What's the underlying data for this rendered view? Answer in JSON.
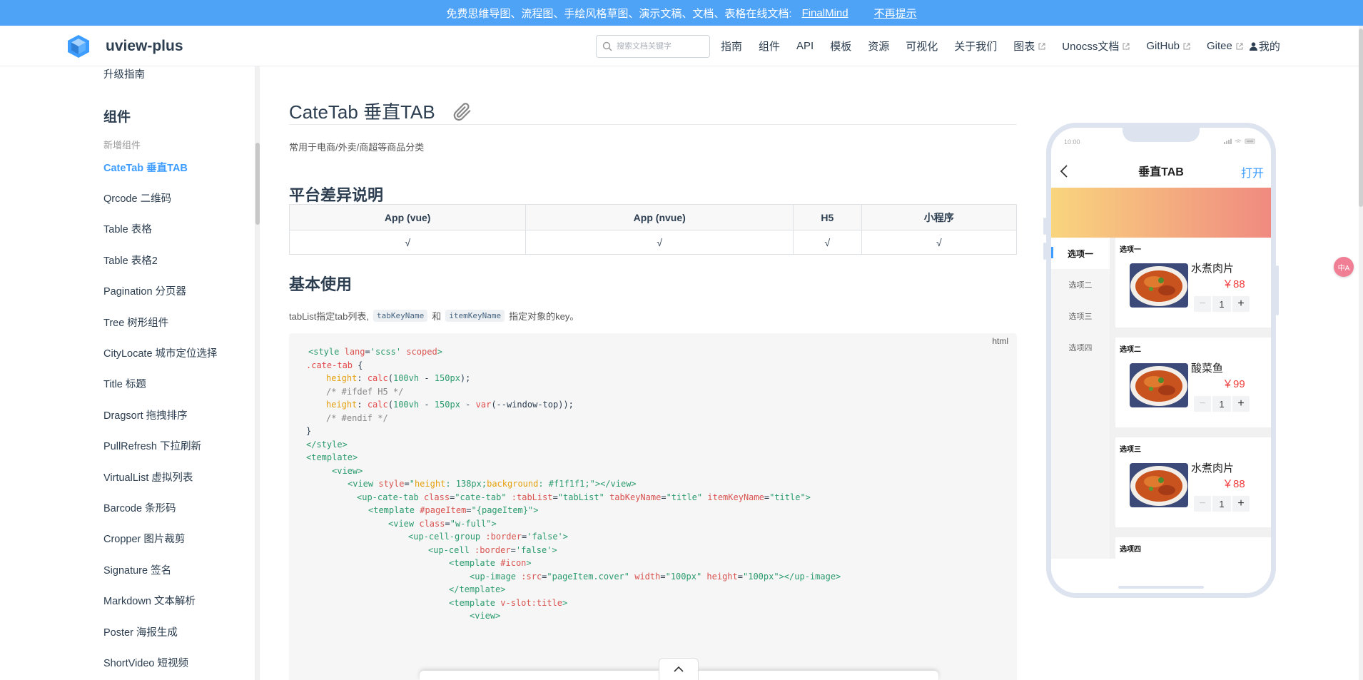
{
  "banner": {
    "text": "免费思维导图、流程图、手绘风格草图、演示文稿、文档、表格在线文档:",
    "link": "FinalMind",
    "dismiss": "不再提示"
  },
  "navbar": {
    "site_name": "uview-plus",
    "search_placeholder": "搜索文档关键字",
    "links": [
      "指南",
      "组件",
      "API",
      "模板",
      "资源",
      "可视化",
      "关于我们"
    ],
    "external_links": [
      "图表",
      "Unocss文档",
      "GitHub",
      "Gitee"
    ],
    "account": "我的"
  },
  "sidebar": {
    "upgrade": "升级指南",
    "group": "组件",
    "subgroup": "新增组件",
    "items": [
      "CateTab 垂直TAB",
      "Qrcode 二维码",
      "Table 表格",
      "Table 表格2",
      "Pagination 分页器",
      "Tree 树形组件",
      "CityLocate 城市定位选择",
      "Title 标题",
      "Dragsort 拖拽排序",
      "PullRefresh 下拉刷新",
      "VirtualList 虚拟列表",
      "Barcode 条形码",
      "Cropper 图片裁剪",
      "Signature 签名",
      "Markdown 文本解析",
      "Poster 海报生成",
      "ShortVideo 短视频"
    ]
  },
  "content": {
    "title": "CateTab 垂直TAB",
    "description": "常用于电商/外卖/商超等商品分类",
    "platform_heading": "平台差异说明",
    "platform_table": {
      "headers": [
        "App (vue)",
        "App (nvue)",
        "H5",
        "小程序"
      ],
      "row": [
        "√",
        "√",
        "√",
        "√"
      ]
    },
    "usage_heading": "基本使用",
    "usage_text_1": "tabList指定tab列表,",
    "usage_code_1": "tabKeyName",
    "usage_and": "和",
    "usage_code_2": "itemKeyName",
    "usage_text_2": "指定对象的key。",
    "code_lang": "html"
  },
  "phone": {
    "time": "10:00",
    "title": "垂直TAB",
    "open": "打开",
    "tabs": [
      "选项一",
      "选项二",
      "选项三",
      "选项四"
    ],
    "sections": [
      {
        "title": "选项一",
        "name": "水煮肉片",
        "price": "￥88",
        "qty": "1"
      },
      {
        "title": "选项二",
        "name": "酸菜鱼",
        "price": "￥99",
        "qty": "1"
      },
      {
        "title": "选项三",
        "name": "水煮肉片",
        "price": "￥88",
        "qty": "1"
      },
      {
        "title": "选项四"
      }
    ],
    "minus": "−",
    "plus": "+"
  },
  "translate_button": "中A",
  "colors": {
    "accent": "#3c9cff",
    "banner": "#4fa3f7",
    "price": "#f03e3e"
  }
}
